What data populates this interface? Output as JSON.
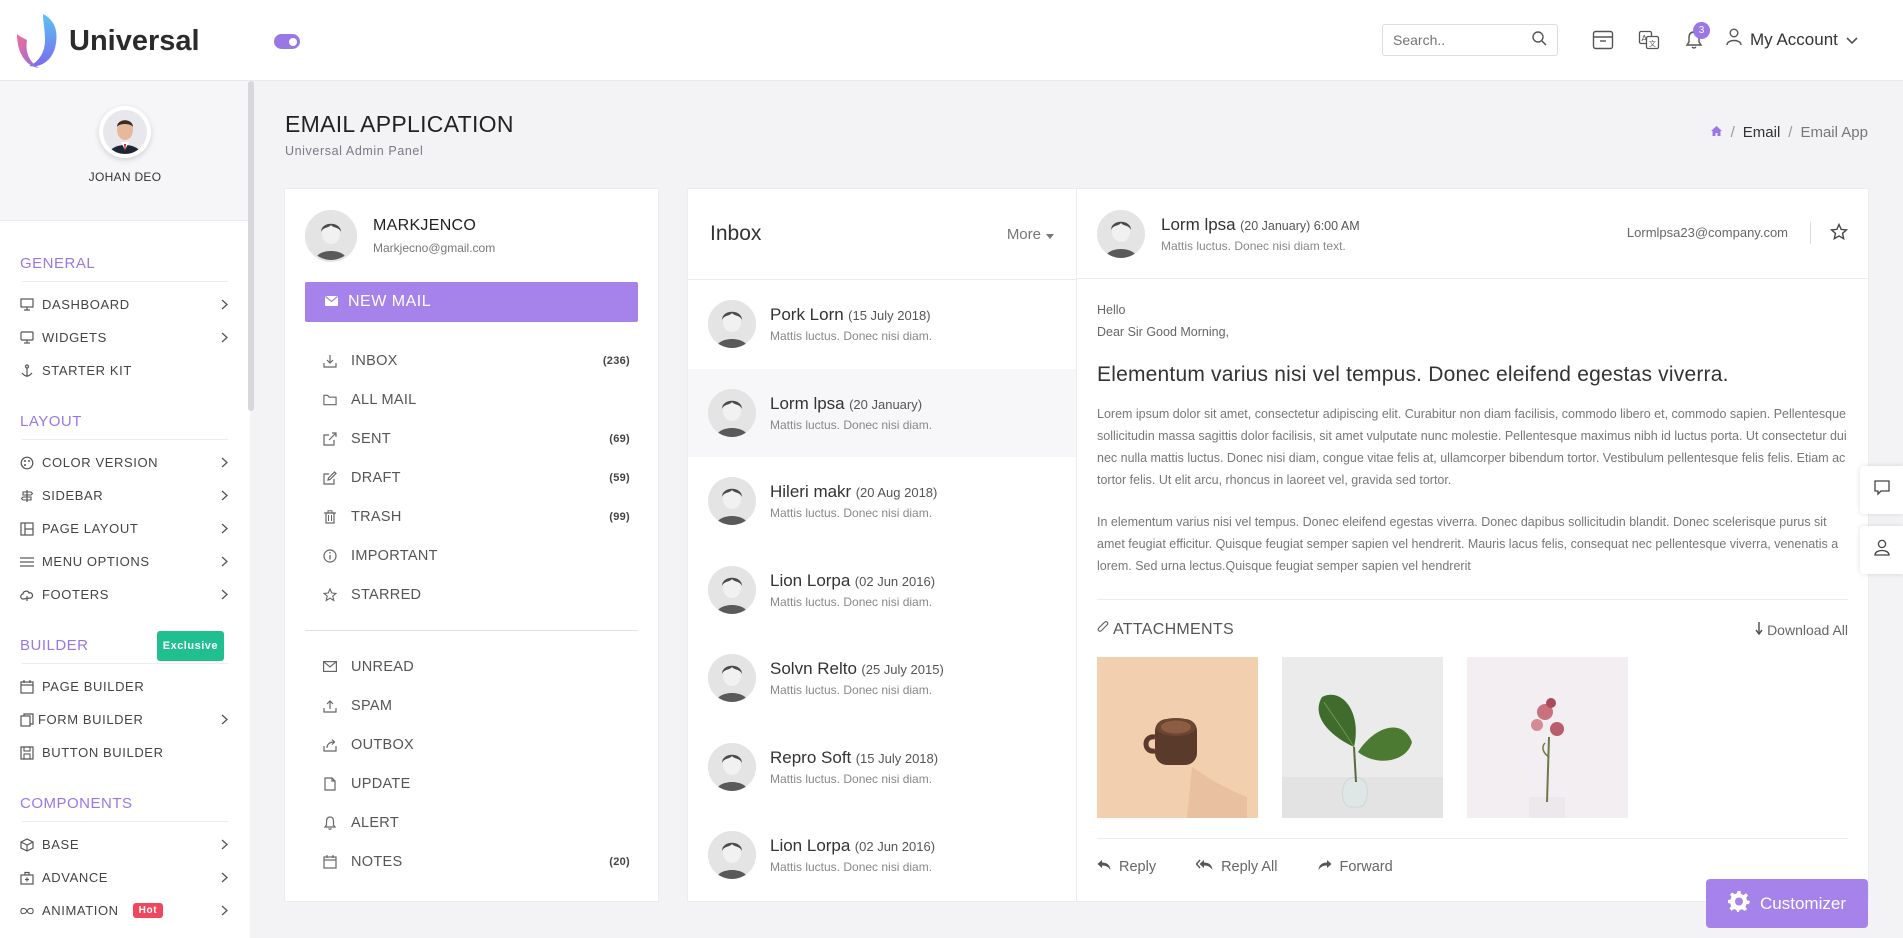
{
  "app": {
    "name": "Universal"
  },
  "header": {
    "search_placeholder": "Search..",
    "notification_count": "3",
    "account_label": "My Account"
  },
  "sidebar": {
    "user_name": "JOHAN DEO",
    "sections": [
      {
        "title": "GENERAL",
        "items": [
          {
            "label": "DASHBOARD",
            "icon": "monitor-icon",
            "arrow": true
          },
          {
            "label": "WIDGETS",
            "icon": "desktop-icon",
            "arrow": true
          },
          {
            "label": "STARTER KIT",
            "icon": "anchor-icon",
            "arrow": false
          }
        ]
      },
      {
        "title": "LAYOUT",
        "items": [
          {
            "label": "COLOR VERSION",
            "icon": "palette-icon",
            "arrow": true
          },
          {
            "label": "SIDEBAR",
            "icon": "signpost-icon",
            "arrow": true
          },
          {
            "label": "PAGE LAYOUT",
            "icon": "layout-icon",
            "arrow": true
          },
          {
            "label": "MENU OPTIONS",
            "icon": "menu-icon",
            "arrow": true
          },
          {
            "label": "FOOTERS",
            "icon": "cloud-icon",
            "arrow": true
          }
        ]
      },
      {
        "title": "BUILDER",
        "tag": "Exclusive",
        "items": [
          {
            "label": "PAGE BUILDER",
            "icon": "calendar-icon",
            "arrow": false
          },
          {
            "label": "FORM BUILDER",
            "icon": "copy-icon",
            "arrow": true
          },
          {
            "label": "BUTTON BUILDER",
            "icon": "save-icon",
            "arrow": false
          }
        ]
      },
      {
        "title": "COMPONENTS",
        "items": [
          {
            "label": "BASE",
            "icon": "box-icon",
            "arrow": true
          },
          {
            "label": "ADVANCE",
            "icon": "briefcase-icon",
            "arrow": true
          },
          {
            "label": "ANIMATION",
            "icon": "infinity-icon",
            "arrow": true,
            "tag": "Hot"
          }
        ]
      }
    ]
  },
  "page": {
    "title": "EMAIL APPLICATION",
    "subtitle": "Universal Admin Panel",
    "breadcrumbs": [
      "Email",
      "Email App"
    ]
  },
  "mailbox": {
    "user_name": "MARKJENCO",
    "user_email": "Markjecno@gmail.com",
    "new_mail_label": "NEW MAIL",
    "folders": [
      {
        "label": "INBOX",
        "count": "(236)",
        "icon": "download-icon"
      },
      {
        "label": "ALL MAIL",
        "count": "",
        "icon": "folder-icon"
      },
      {
        "label": "SENT",
        "count": "(69)",
        "icon": "external-link-icon"
      },
      {
        "label": "DRAFT",
        "count": "(59)",
        "icon": "edit-icon"
      },
      {
        "label": "TRASH",
        "count": "(99)",
        "icon": "trash-icon"
      },
      {
        "label": "IMPORTANT",
        "count": "",
        "icon": "info-icon"
      },
      {
        "label": "STARRED",
        "count": "",
        "icon": "star-icon"
      }
    ],
    "labels": [
      {
        "label": "UNREAD",
        "count": "",
        "icon": "mail-icon"
      },
      {
        "label": "SPAM",
        "count": "",
        "icon": "upload-icon"
      },
      {
        "label": "OUTBOX",
        "count": "",
        "icon": "share-icon"
      },
      {
        "label": "UPDATE",
        "count": "",
        "icon": "file-icon"
      },
      {
        "label": "ALERT",
        "count": "",
        "icon": "bell-icon"
      },
      {
        "label": "NOTES",
        "count": "(20)",
        "icon": "calendar-icon"
      }
    ]
  },
  "inbox": {
    "title": "Inbox",
    "more_label": "More",
    "mails": [
      {
        "name": "Pork Lorn",
        "date": "(15 July 2018)",
        "preview": "Mattis luctus. Donec nisi diam.",
        "active": false
      },
      {
        "name": "Lorm lpsa",
        "date": "(20 January)",
        "preview": "Mattis luctus. Donec nisi diam.",
        "active": true
      },
      {
        "name": "Hileri makr",
        "date": "(20 Aug 2018)",
        "preview": "Mattis luctus. Donec nisi diam.",
        "active": false
      },
      {
        "name": "Lion Lorpa",
        "date": "(02 Jun 2016)",
        "preview": "Mattis luctus. Donec nisi diam.",
        "active": false
      },
      {
        "name": "Solvn Relto",
        "date": "(25 July 2015)",
        "preview": "Mattis luctus. Donec nisi diam.",
        "active": false
      },
      {
        "name": "Repro Soft",
        "date": "(15 July 2018)",
        "preview": "Mattis luctus. Donec nisi diam.",
        "active": false
      },
      {
        "name": "Lion Lorpa",
        "date": "(02 Jun 2016)",
        "preview": "Mattis luctus. Donec nisi diam.",
        "active": false
      }
    ]
  },
  "reader": {
    "sender": "Lorm lpsa",
    "date": "(20 January) 6:00 AM",
    "preview": "Mattis luctus. Donec nisi diam text.",
    "email": "Lormlpsa23@company.com",
    "greeting": "Hello",
    "salutation": "Dear Sir Good Morning,",
    "subject": "Elementum varius nisi vel tempus. Donec eleifend egestas viverra.",
    "paragraph1": "Lorem ipsum dolor sit amet, consectetur adipiscing elit. Curabitur non diam facilisis, commodo libero et, commodo sapien. Pellentesque sollicitudin massa sagittis dolor facilisis, sit amet vulputate nunc molestie. Pellentesque maximus nibh id luctus porta. Ut consectetur dui nec nulla mattis luctus. Donec nisi diam, congue vitae felis at, ullamcorper bibendum tortor. Vestibulum pellentesque felis felis. Etiam ac tortor felis. Ut elit arcu, rhoncus in laoreet vel, gravida sed tortor.",
    "paragraph2": "In elementum varius nisi vel tempus. Donec eleifend egestas viverra. Donec dapibus sollicitudin blandit. Donec scelerisque purus sit amet feugiat efficitur. Quisque feugiat semper sapien vel hendrerit. Mauris lacus felis, consequat nec pellentesque viverra, venenatis a lorem. Sed urna lectus.Quisque feugiat semper sapien vel hendrerit",
    "attachments_label": "ATTACHMENTS",
    "download_all_label": "Download All",
    "reply_label": "Reply",
    "reply_all_label": "Reply All",
    "forward_label": "Forward"
  },
  "customizer": {
    "label": "Customizer"
  },
  "colors": {
    "accent": "#a682eb",
    "exclusive": "#1fbf8f",
    "hot": "#f0475f"
  }
}
